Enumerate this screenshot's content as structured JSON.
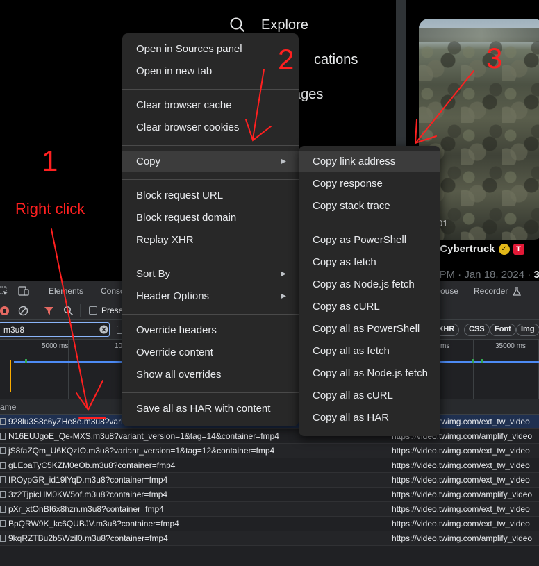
{
  "twitter": {
    "nav": [
      {
        "label": "Explore",
        "icon": "search-icon"
      },
      {
        "label": "cations"
      },
      {
        "label": "ages"
      }
    ],
    "media_tag": "01",
    "author": "n Cybertruck",
    "time": "5 PM · Jan 18, 2024 · ",
    "time_suffix": "3"
  },
  "devtools": {
    "tabs": [
      "Elements",
      "Conso",
      "ouse",
      "Recorder"
    ],
    "preserve_label": "Prese",
    "filter_value": "m3u8",
    "type_chips": [
      "/XHR",
      "CSS",
      "Font",
      "Img"
    ],
    "timeline_labels": [
      "5000 ms",
      "10",
      "ms",
      "35000 ms"
    ],
    "table": {
      "name_header": "ame",
      "rows": [
        {
          "name": "928lu3S8c6yZHe8e.m3u8?vari",
          "url": ""
        },
        {
          "name": "N16EUJgoE_Qe-MXS.m3u8?variant_version=1&tag=14&container=fmp4",
          "url": "https://video.twimg.com/amplify_video"
        },
        {
          "name": "jS8faZQm_U6KQzIO.m3u8?variant_version=1&tag=12&container=fmp4",
          "url": "https://video.twimg.com/ext_tw_video"
        },
        {
          "name": "gLEoaTyC5KZM0eOb.m3u8?container=fmp4",
          "url": "https://video.twimg.com/ext_tw_video"
        },
        {
          "name": "IROypGR_id19lYqD.m3u8?container=fmp4",
          "url": "https://video.twimg.com/ext_tw_video"
        },
        {
          "name": "3z2TjpicHM0KW5of.m3u8?container=fmp4",
          "url": "https://video.twimg.com/amplify_video"
        },
        {
          "name": "pXr_xtOnBI6x8hzn.m3u8?container=fmp4",
          "url": "https://video.twimg.com/ext_tw_video"
        },
        {
          "name": "BpQRW9K_kc6QUBJV.m3u8?container=fmp4",
          "url": "https://video.twimg.com/ext_tw_video"
        },
        {
          "name": "9kqRZTBu2b5Wzil0.m3u8?container=fmp4",
          "url": "https://video.twimg.com/amplify_video"
        }
      ],
      "first_row_url": "https://video.twimg.com/ext_tw_video"
    }
  },
  "context_menu": {
    "items": [
      "Open in Sources panel",
      "Open in new tab",
      "Clear browser cache",
      "Clear browser cookies",
      "Copy",
      "Block request URL",
      "Block request domain",
      "Replay XHR",
      "Sort By",
      "Header Options",
      "Override headers",
      "Override content",
      "Show all overrides",
      "Save all as HAR with content"
    ]
  },
  "copy_submenu": {
    "items": [
      "Copy link address",
      "Copy response",
      "Copy stack trace",
      "Copy as PowerShell",
      "Copy as fetch",
      "Copy as Node.js fetch",
      "Copy as cURL",
      "Copy all as PowerShell",
      "Copy all as fetch",
      "Copy all as Node.js fetch",
      "Copy all as cURL",
      "Copy all as HAR"
    ]
  },
  "annotations": {
    "step1": "1",
    "step1_text": "Right click",
    "step2": "2",
    "step3": "3"
  },
  "colors": {
    "annotation": "#ff2020",
    "menu_bg": "#282828",
    "menu_highlight": "#3c3c3c",
    "devtools_bg": "#202124",
    "timeline_blue": "#4d8bf5"
  }
}
